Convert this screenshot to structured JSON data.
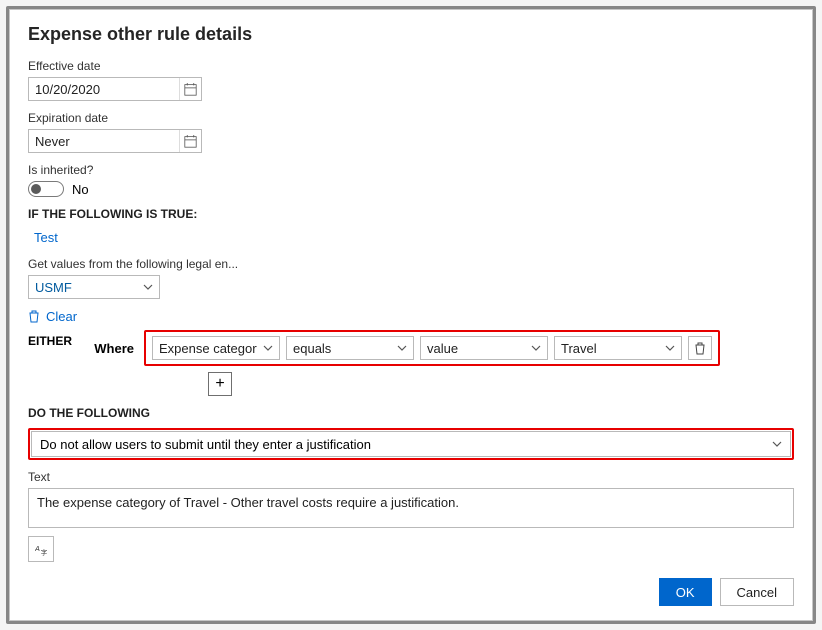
{
  "title": "Expense other rule details",
  "dates": {
    "effective_label": "Effective date",
    "effective_value": "10/20/2020",
    "expiration_label": "Expiration date",
    "expiration_value": "Never"
  },
  "inherited": {
    "label": "Is inherited?",
    "value": "No"
  },
  "conditions": {
    "section_label": "IF THE FOLLOWING IS TRUE:",
    "test_link": "Test",
    "legal_entity_label": "Get values from the following legal en...",
    "legal_entity_value": "USMF",
    "clear_label": "Clear",
    "either_label": "EITHER",
    "where_label": "Where",
    "field_value": "Expense category",
    "operator_value": "equals",
    "comparetype_value": "value",
    "compare_value": "Travel",
    "add_label": "+"
  },
  "actions": {
    "section_label": "DO THE FOLLOWING",
    "selected": "Do not allow users to submit until they enter a justification",
    "text_label": "Text",
    "text_value": "The expense category of Travel - Other travel costs require a justification."
  },
  "footer": {
    "ok": "OK",
    "cancel": "Cancel"
  }
}
